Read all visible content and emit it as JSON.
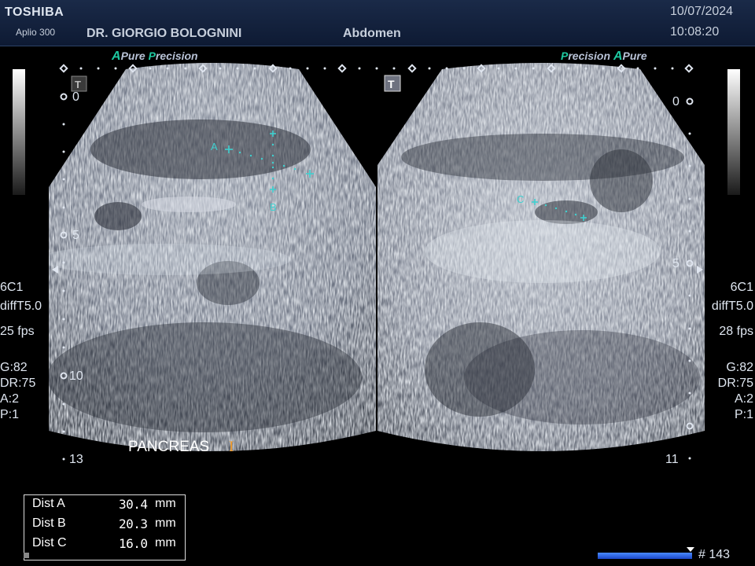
{
  "header": {
    "brand": "TOSHIBA",
    "model": "Aplio 300",
    "doctor": "DR. GIORGIO BOLOGNINI",
    "exam": "Abdomen",
    "date": "10/07/2024",
    "time": "10:08:20"
  },
  "left_panel": {
    "pure_precision": {
      "a": "A",
      "pure": "Pure",
      "p": "P",
      "precision": "recision"
    },
    "depth_ticks": [
      "0",
      "5",
      "10",
      "13"
    ],
    "probe": "6C1",
    "diff": "diffT5.0",
    "fps": "25 fps",
    "gain": "G:82",
    "dr": "DR:75",
    "a": "A:2",
    "p": "P:1",
    "organ_label": "PANCREAS",
    "cursor_glyph": "I"
  },
  "right_panel": {
    "pure_precision": {
      "p": "P",
      "precision": "recision",
      "a": "A",
      "pure": "Pure"
    },
    "depth_ticks": [
      "0",
      "5",
      "11"
    ],
    "probe": "6C1",
    "diff": "diffT5.0",
    "fps": "28 fps",
    "gain": "G:82",
    "dr": "DR:75",
    "a": "A:2",
    "p": "P:1"
  },
  "calipers": {
    "a": "A",
    "b": "B",
    "c": "C",
    "t": "T"
  },
  "measurements": [
    {
      "label": "Dist A",
      "value": "30.4",
      "unit": "mm"
    },
    {
      "label": "Dist B",
      "value": "20.3",
      "unit": "mm"
    },
    {
      "label": "Dist C",
      "value": "16.0",
      "unit": "mm"
    }
  ],
  "cine": {
    "frame": "# 143",
    "progress": 0.95
  },
  "colors": {
    "caliper": "#3fd0d0",
    "accent": "#1ec8a0",
    "cursor": "#f09a2a"
  }
}
